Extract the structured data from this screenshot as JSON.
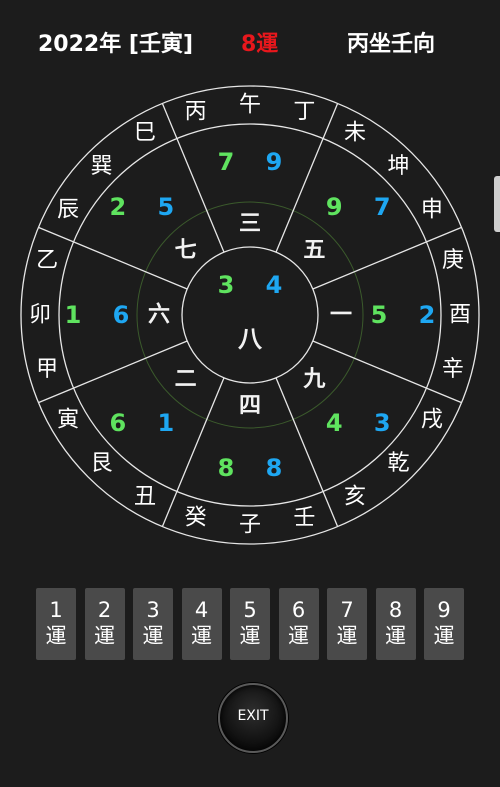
{
  "header": {
    "year_label": "2022年 [壬寅]",
    "period_label": "8運",
    "facing_label": "丙坐壬向"
  },
  "colors": {
    "green": "#5fe35f",
    "blue": "#1ea7f2",
    "red": "#e8171c",
    "background": "#1c1c1c",
    "button": "#4a4a4a"
  },
  "chart": {
    "outer_ring": [
      {
        "id": "bing",
        "text": "丙"
      },
      {
        "id": "wu",
        "text": "午"
      },
      {
        "id": "ding",
        "text": "丁"
      },
      {
        "id": "wei",
        "text": "未"
      },
      {
        "id": "kun",
        "text": "坤"
      },
      {
        "id": "shen",
        "text": "申"
      },
      {
        "id": "geng",
        "text": "庚"
      },
      {
        "id": "you",
        "text": "酉"
      },
      {
        "id": "xin",
        "text": "辛"
      },
      {
        "id": "xu",
        "text": "戌"
      },
      {
        "id": "qian",
        "text": "乾"
      },
      {
        "id": "hai",
        "text": "亥"
      },
      {
        "id": "ren",
        "text": "壬"
      },
      {
        "id": "zi",
        "text": "子"
      },
      {
        "id": "gui",
        "text": "癸"
      },
      {
        "id": "chou",
        "text": "丑"
      },
      {
        "id": "gen",
        "text": "艮"
      },
      {
        "id": "yin",
        "text": "寅"
      },
      {
        "id": "jia",
        "text": "甲"
      },
      {
        "id": "mao",
        "text": "卯"
      },
      {
        "id": "yi",
        "text": "乙"
      },
      {
        "id": "chen",
        "text": "辰"
      },
      {
        "id": "xun",
        "text": "巽"
      },
      {
        "id": "si",
        "text": "巳"
      }
    ],
    "palaces": [
      {
        "id": "south",
        "mountain": "7",
        "water": "9",
        "base": "三"
      },
      {
        "id": "southwest",
        "mountain": "9",
        "water": "7",
        "base": "五"
      },
      {
        "id": "west",
        "mountain": "5",
        "water": "2",
        "base": "一"
      },
      {
        "id": "northwest",
        "mountain": "4",
        "water": "3",
        "base": "九"
      },
      {
        "id": "north",
        "mountain": "8",
        "water": "8",
        "base": "四"
      },
      {
        "id": "northeast",
        "mountain": "6",
        "water": "1",
        "base": "二"
      },
      {
        "id": "east",
        "mountain": "1",
        "water": "6",
        "base": "六"
      },
      {
        "id": "southeast",
        "mountain": "2",
        "water": "5",
        "base": "七"
      }
    ],
    "center": {
      "mountain": "3",
      "water": "4",
      "base": "八"
    }
  },
  "period_buttons": [
    {
      "num": "1",
      "unit": "運"
    },
    {
      "num": "2",
      "unit": "運"
    },
    {
      "num": "3",
      "unit": "運"
    },
    {
      "num": "4",
      "unit": "運"
    },
    {
      "num": "5",
      "unit": "運"
    },
    {
      "num": "6",
      "unit": "運"
    },
    {
      "num": "7",
      "unit": "運"
    },
    {
      "num": "8",
      "unit": "運"
    },
    {
      "num": "9",
      "unit": "運"
    }
  ],
  "exit_label": "EXIT"
}
